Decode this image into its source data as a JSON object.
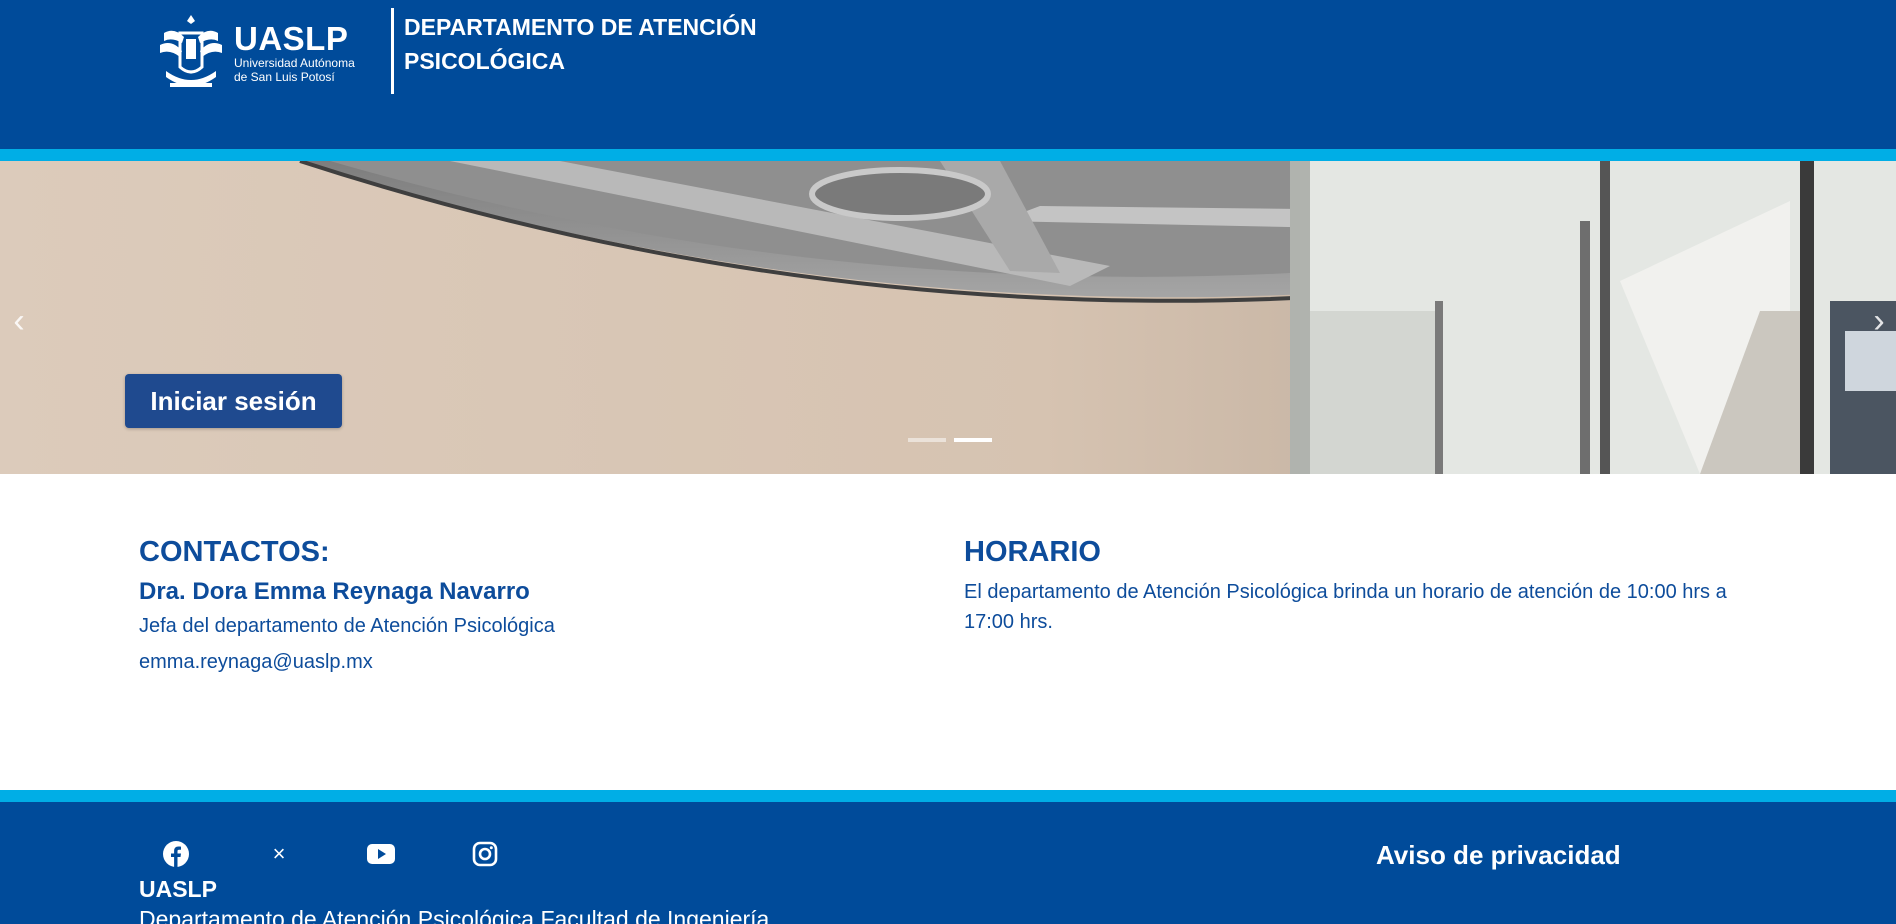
{
  "header": {
    "logo": {
      "name": "UASLP",
      "subtitle_line1": "Universidad Autónoma",
      "subtitle_line2": "de San Luis Potosí"
    },
    "department_line1": "DEPARTAMENTO DE ATENCIÓN",
    "department_line2": "PSICOLÓGICA"
  },
  "hero": {
    "prev_icon": "‹",
    "next_icon": "›",
    "login_label": "Iniciar sesión",
    "slides_count": 2,
    "active_slide": 2
  },
  "contacts": {
    "heading": "CONTACTOS:",
    "name": "Dra. Dora Emma Reynaga Navarro",
    "role": "Jefa del departamento de Atención Psicológica",
    "email": "emma.reynaga@uaslp.mx"
  },
  "schedule": {
    "heading": "HORARIO",
    "text": "El departamento de Atención Psicológica brinda un horario de atención de 10:00 hrs a 17:00 hrs."
  },
  "footer": {
    "social_icons": [
      "facebook-icon",
      "x-icon",
      "youtube-icon",
      "instagram-icon"
    ],
    "x_glyph": "×",
    "org": "UASLP",
    "address": "Departamento de Atención Psicológica Facultad de Ingeniería",
    "privacy_label": "Aviso de privacidad"
  },
  "colors": {
    "header_blue": "#004b9a",
    "accent_cyan": "#00aee6",
    "button_blue": "#1f4a8f",
    "text_blue": "#0d4c9b"
  }
}
